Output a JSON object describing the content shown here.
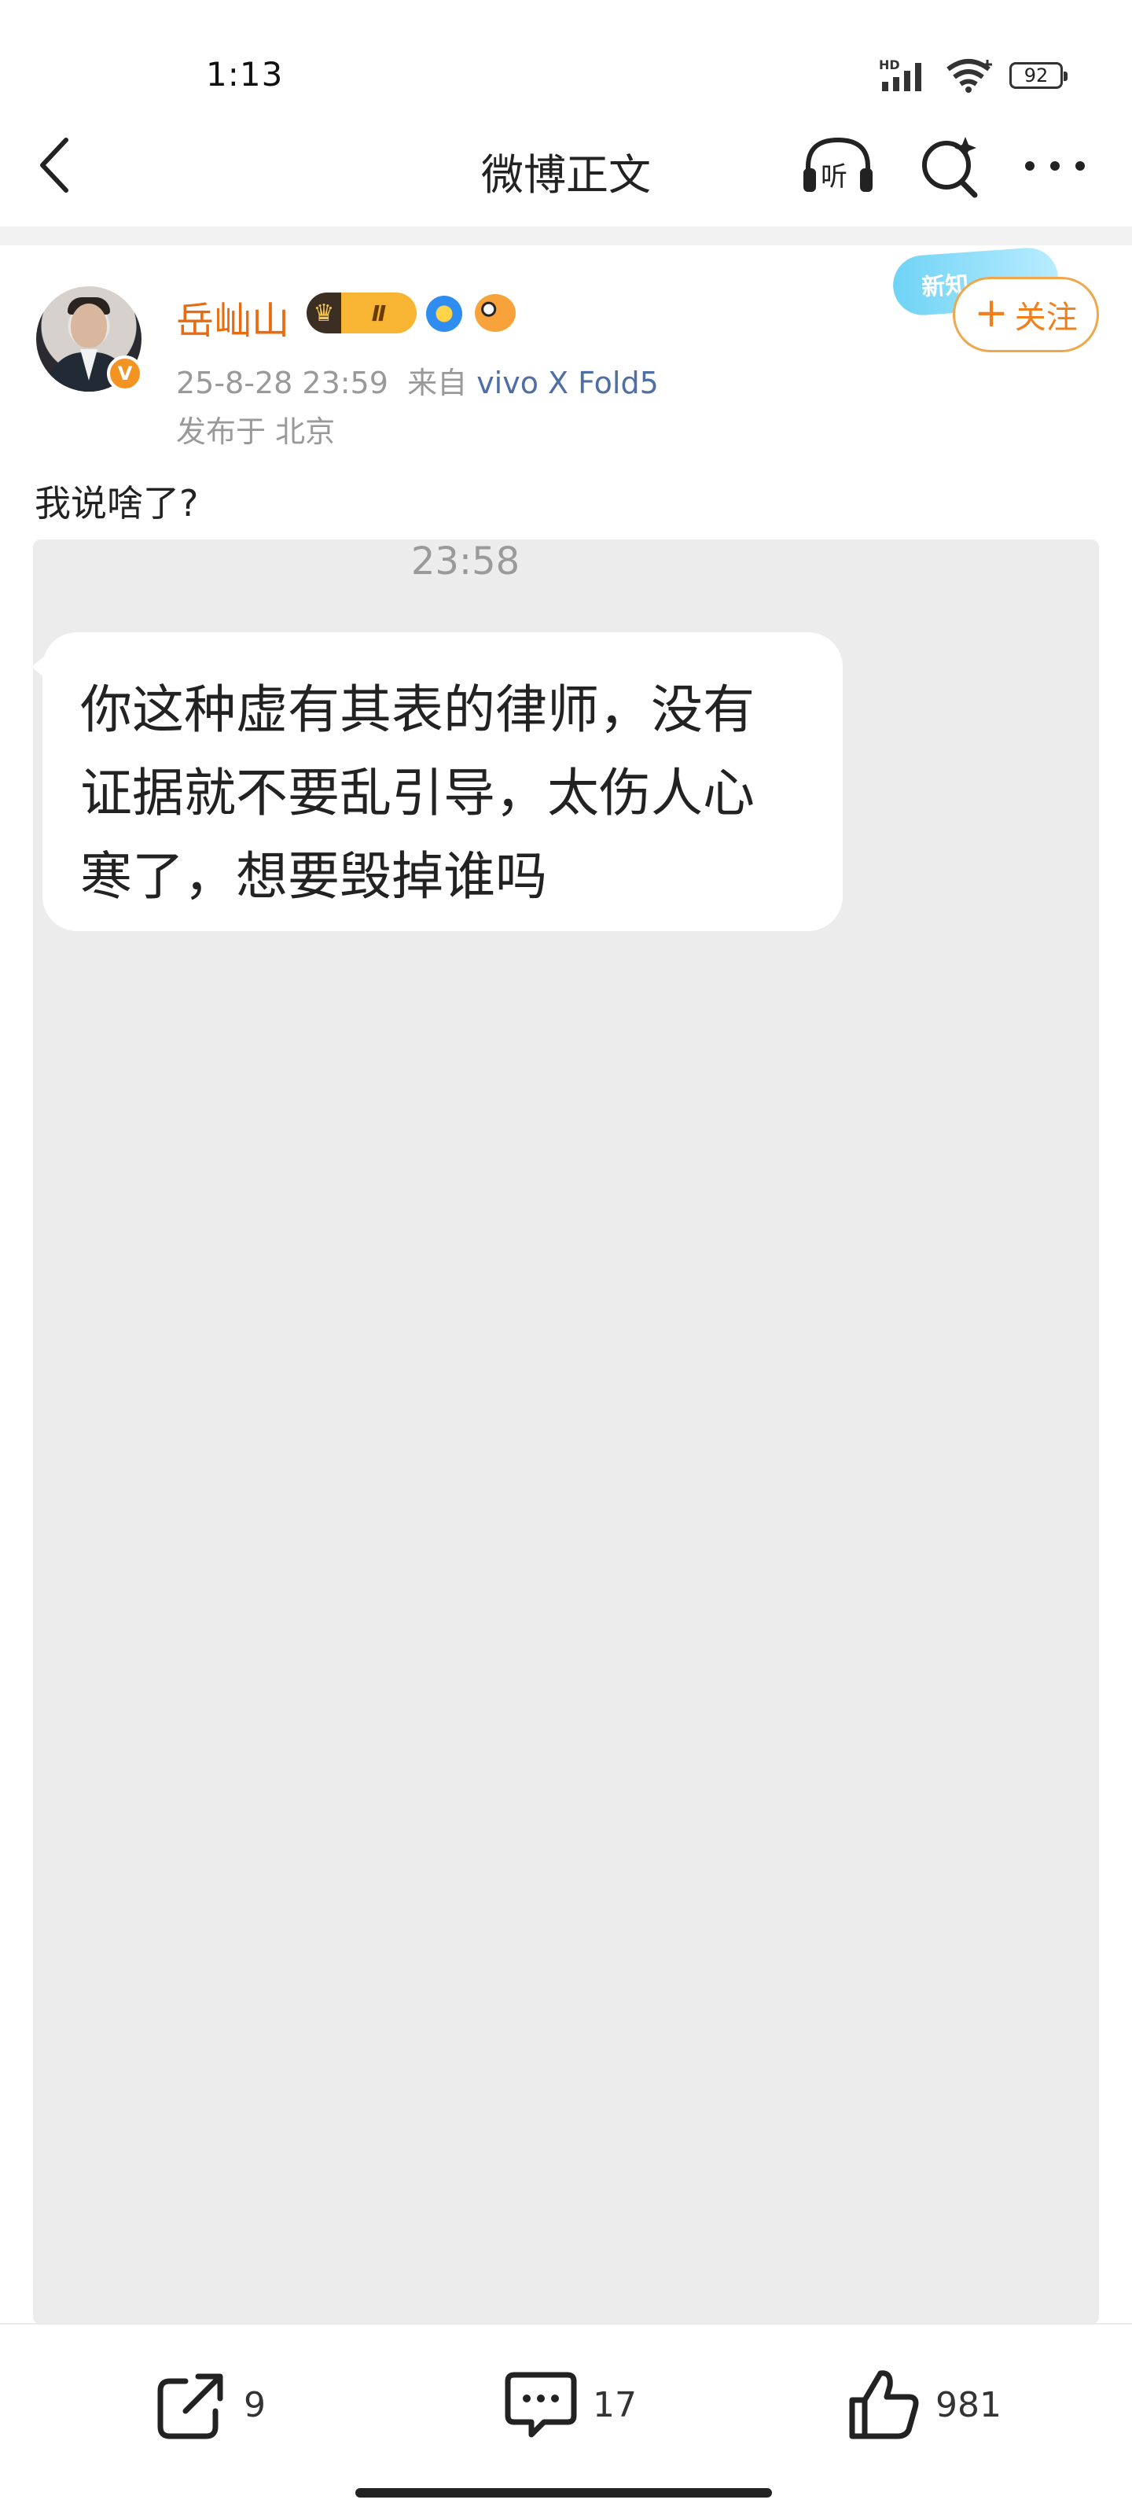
{
  "status_bar": {
    "time": "1:13",
    "hd_label": "HD",
    "battery": "92"
  },
  "nav": {
    "title": "微博正文",
    "listen_label": "听"
  },
  "post": {
    "author": "岳屾山",
    "level_badge": "Ⅱ",
    "date": "25-8-28 23:59",
    "source_prefix": "来自",
    "device": "vivo X Fold5",
    "location": "发布于 北京",
    "text": "我说啥了?",
    "new_tag": "新知",
    "follow_label": "关注"
  },
  "image": {
    "chat_time": "23:58",
    "message": "你这种虚有其表的律师，没有证据就不要乱引导，太伤人心寒了，想要毁掉谁吗"
  },
  "actions": {
    "repost_count": "9",
    "comment_count": "17",
    "like_count": "981"
  },
  "colors": {
    "username": "#e86b0f",
    "follow": "#f07f1c",
    "device_link": "#4f6ea5"
  }
}
